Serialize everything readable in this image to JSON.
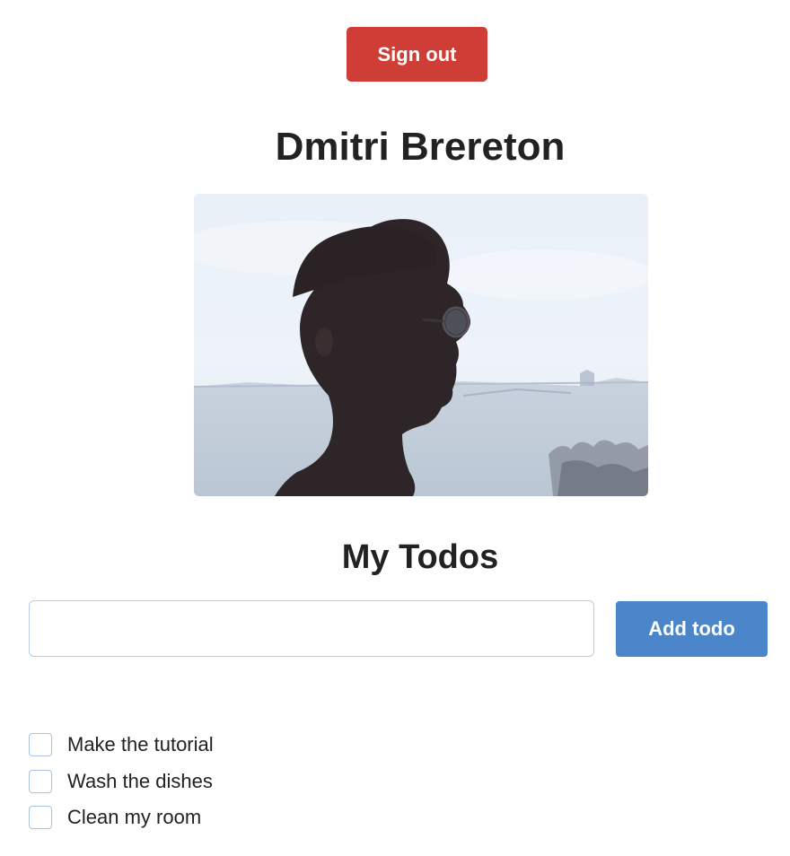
{
  "header": {
    "signout_label": "Sign out"
  },
  "profile": {
    "name": "Dmitri Brereton",
    "photo_alt": "Profile photo"
  },
  "todos": {
    "heading": "My Todos",
    "input_value": "",
    "input_placeholder": "",
    "add_label": "Add todo",
    "items": [
      {
        "label": "Make the tutorial",
        "done": false
      },
      {
        "label": "Wash the dishes",
        "done": false
      },
      {
        "label": "Clean my room",
        "done": false
      }
    ]
  },
  "colors": {
    "signout": "#cf3e36",
    "primary": "#4a86c9",
    "text": "#222222",
    "input_border": "#b7cde6"
  }
}
